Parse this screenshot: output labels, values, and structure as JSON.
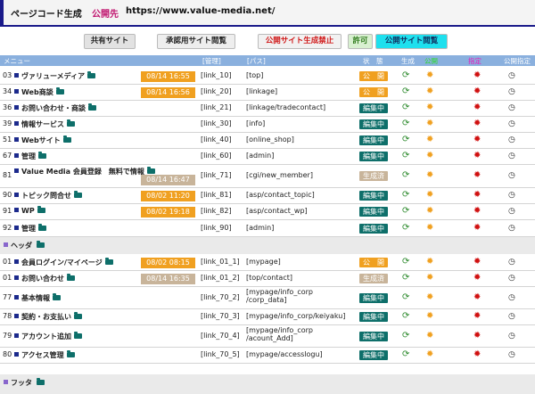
{
  "header": {
    "title": "ページコード生成",
    "public_label": "公開先",
    "public_url": "https://www.value-media.net/"
  },
  "toolbar": {
    "shared_site": "共有サイト",
    "approval_site": "承認用サイト閲覧",
    "public_prohibit": "公開サイト生成禁止",
    "permit": "許可",
    "public_site": "公開サイト閲覧"
  },
  "table": {
    "headers": {
      "menu": "メニュー",
      "manage": "[管理]",
      "path": "[パス]",
      "state": "状　態",
      "gen": "生成",
      "pub": "公開",
      "designate": "指定",
      "pub_designate": "公開指定"
    },
    "sections": {
      "header": "ヘッダ",
      "footer": "フッタ"
    },
    "status_colors": {
      "公　開": "#f0a020",
      "編集中": "#0e6f6a",
      "生成済": "#c8b49a"
    },
    "date_colors": {
      "orange": "#f0a020",
      "tan": "#c8b49a"
    },
    "rows": [
      {
        "num": "03",
        "menu": "ヴァリューメディア",
        "date": "08/14 16:55",
        "date_color": "orange",
        "manage": "[link_10]",
        "path": "[top]",
        "status": "公　開"
      },
      {
        "num": "34",
        "menu": "Web商談",
        "date": "08/14 16:56",
        "date_color": "orange",
        "manage": "[link_20]",
        "path": "[linkage]",
        "status": "公　開"
      },
      {
        "num": "36",
        "menu": "お問い合わせ・商談",
        "date": "",
        "date_color": "",
        "manage": "[link_21]",
        "path": "[linkage/tradecontact]",
        "status": "編集中"
      },
      {
        "num": "39",
        "menu": "情報サービス",
        "date": "",
        "date_color": "",
        "manage": "[link_30]",
        "path": "[info]",
        "status": "編集中"
      },
      {
        "num": "51",
        "menu": "Webサイト",
        "date": "",
        "date_color": "",
        "manage": "[link_40]",
        "path": "[online_shop]",
        "status": "編集中"
      },
      {
        "num": "67",
        "menu": "管理",
        "date": "",
        "date_color": "",
        "manage": "[link_60]",
        "path": "[admin]",
        "status": "編集中"
      },
      {
        "num": "81",
        "menu": "Value Media 会員登録　無料で情報",
        "date": "08/14 16:47",
        "date_color": "tan",
        "manage": "[link_71]",
        "path": "[cgi/new_member]",
        "status": "生成済"
      },
      {
        "num": "90",
        "menu": "トピック問合せ",
        "date": "08/02 11:20",
        "date_color": "orange",
        "manage": "[link_81]",
        "path": "[asp/contact_topic]",
        "status": "編集中"
      },
      {
        "num": "91",
        "menu": "WP",
        "date": "08/02 19:18",
        "date_color": "orange",
        "manage": "[link_82]",
        "path": "[asp/contact_wp]",
        "status": "編集中"
      },
      {
        "num": "92",
        "menu": "管理",
        "date": "",
        "date_color": "",
        "manage": "[link_90]",
        "path": "[admin]",
        "status": "編集中"
      }
    ],
    "header_rows": [
      {
        "num": "01",
        "menu": "会員ログイン/マイページ",
        "date": "08/02 08:15",
        "date_color": "orange",
        "manage": "[link_01_1]",
        "path": "[mypage]",
        "status": "公　開"
      },
      {
        "num": "01",
        "menu": "お問い合わせ",
        "date": "08/14 16:35",
        "date_color": "tan",
        "manage": "[link_01_2]",
        "path": "[top/contact]",
        "status": "生成済"
      },
      {
        "num": "77",
        "menu": "基本情報",
        "date": "",
        "date_color": "",
        "manage": "[link_70_2]",
        "path": "[mypage/info_corp\n/corp_data]",
        "status": "編集中"
      },
      {
        "num": "78",
        "menu": "契約・お支払い",
        "date": "",
        "date_color": "",
        "manage": "[link_70_3]",
        "path": "[mypage/info_corp/keiyaku]",
        "status": "編集中"
      },
      {
        "num": "79",
        "menu": "アカウント追加",
        "date": "",
        "date_color": "",
        "manage": "[link_70_4]",
        "path": "[mypage/info_corp\n/acount_Add]",
        "status": "編集中"
      },
      {
        "num": "80",
        "menu": "アクセス管理",
        "date": "",
        "date_color": "",
        "manage": "[link_70_5]",
        "path": "[mypage/accesslogu]",
        "status": "編集中"
      }
    ]
  }
}
